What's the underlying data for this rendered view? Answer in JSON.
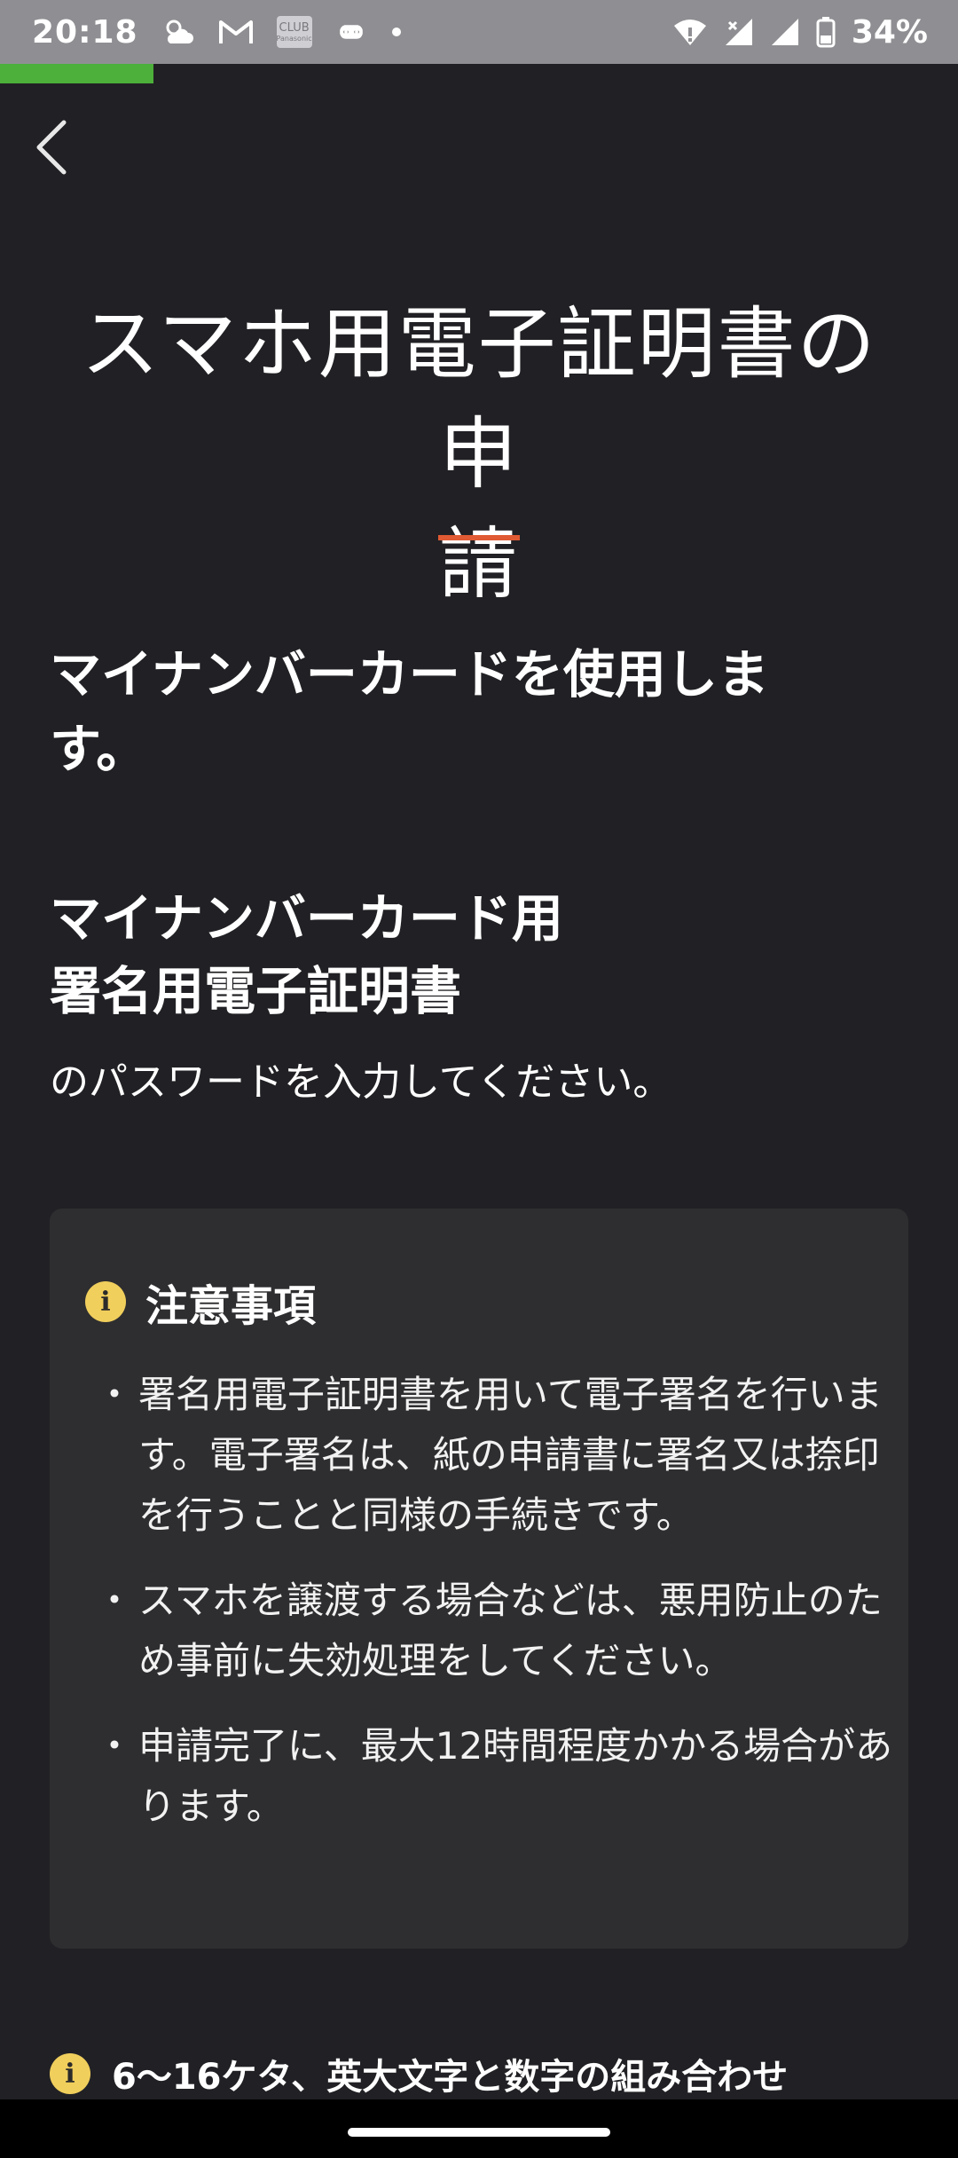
{
  "status_bar": {
    "time": "20:18",
    "battery": "34%",
    "left_icons": [
      "weather-icon",
      "gmail-icon",
      "club-panasonic-icon",
      "command-icon",
      "dot-icon"
    ],
    "club_label": "CLUB",
    "club_sub": "Panasonic",
    "right_icons": [
      "wifi-icon",
      "signal-icon",
      "signal-icon",
      "battery-icon"
    ]
  },
  "progress": {
    "value": 0.16,
    "color": "#4cb03a"
  },
  "header": {
    "back_icon": "chevron-left-icon"
  },
  "title": {
    "line1": "スマホ用電子証明書の申",
    "line2": "請",
    "underline_color": "#e05a33"
  },
  "main": {
    "heading_line1": "マイナンバーカードを使用しま",
    "heading_line2": "す。",
    "subheading_line1": "マイナンバーカード用",
    "subheading_line2": "署名用電子証明書",
    "instruction": "のパスワードを入力してください。"
  },
  "notice": {
    "title": "注意事項",
    "icon": "info-icon",
    "items": [
      "署名用電子証明書を用いて電子署名を行います。電子署名は、紙の申請書に署名又は捺印を行うことと同様の手続きです。",
      "スマホを譲渡する場合などは、悪用防止のため事前に失効処理をしてください。",
      "申請完了に、最大12時間程度かかる場合があります。"
    ]
  },
  "password_hint": {
    "icon": "info-icon",
    "text": "6〜16ケタ、英大文字と数字の組み合わせ"
  },
  "colors": {
    "background": "#212125",
    "status_bar": "#8f8f93",
    "notice_bg": "#2e2e30",
    "info_yellow": "#f1cf5c"
  }
}
